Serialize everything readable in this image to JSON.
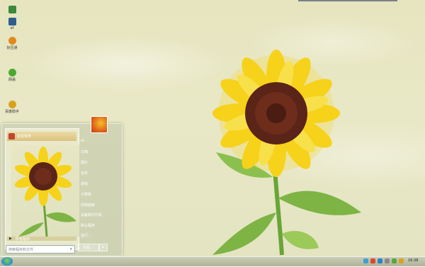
{
  "desktop": {
    "icons": [
      {
        "label": "",
        "color": "#3a8a3a"
      },
      {
        "label": "ef",
        "color": "#2e5d8f"
      },
      {
        "label": "好压通",
        "color": "#e08a1e"
      },
      {
        "label": "网易",
        "color": "#4caa2c"
      },
      {
        "label": "百度助手",
        "color": "#d9a21e"
      }
    ]
  },
  "start_menu": {
    "pinned_label": "花花世界",
    "all_programs_label": "所有程序",
    "search_placeholder": "搜索程序和文件",
    "right_items": [
      "ef",
      "文档",
      "图片",
      "音乐",
      "游戏",
      "计算机",
      "控制面板",
      "设备和打印机",
      "默认程序",
      "运行..."
    ],
    "shutdown_label": "关机",
    "shutdown_arrow": "▸"
  },
  "taskbar": {
    "clock": "16:38"
  },
  "colors": {
    "accent": "#f6c02a",
    "taskbar": "#b9bea5"
  }
}
